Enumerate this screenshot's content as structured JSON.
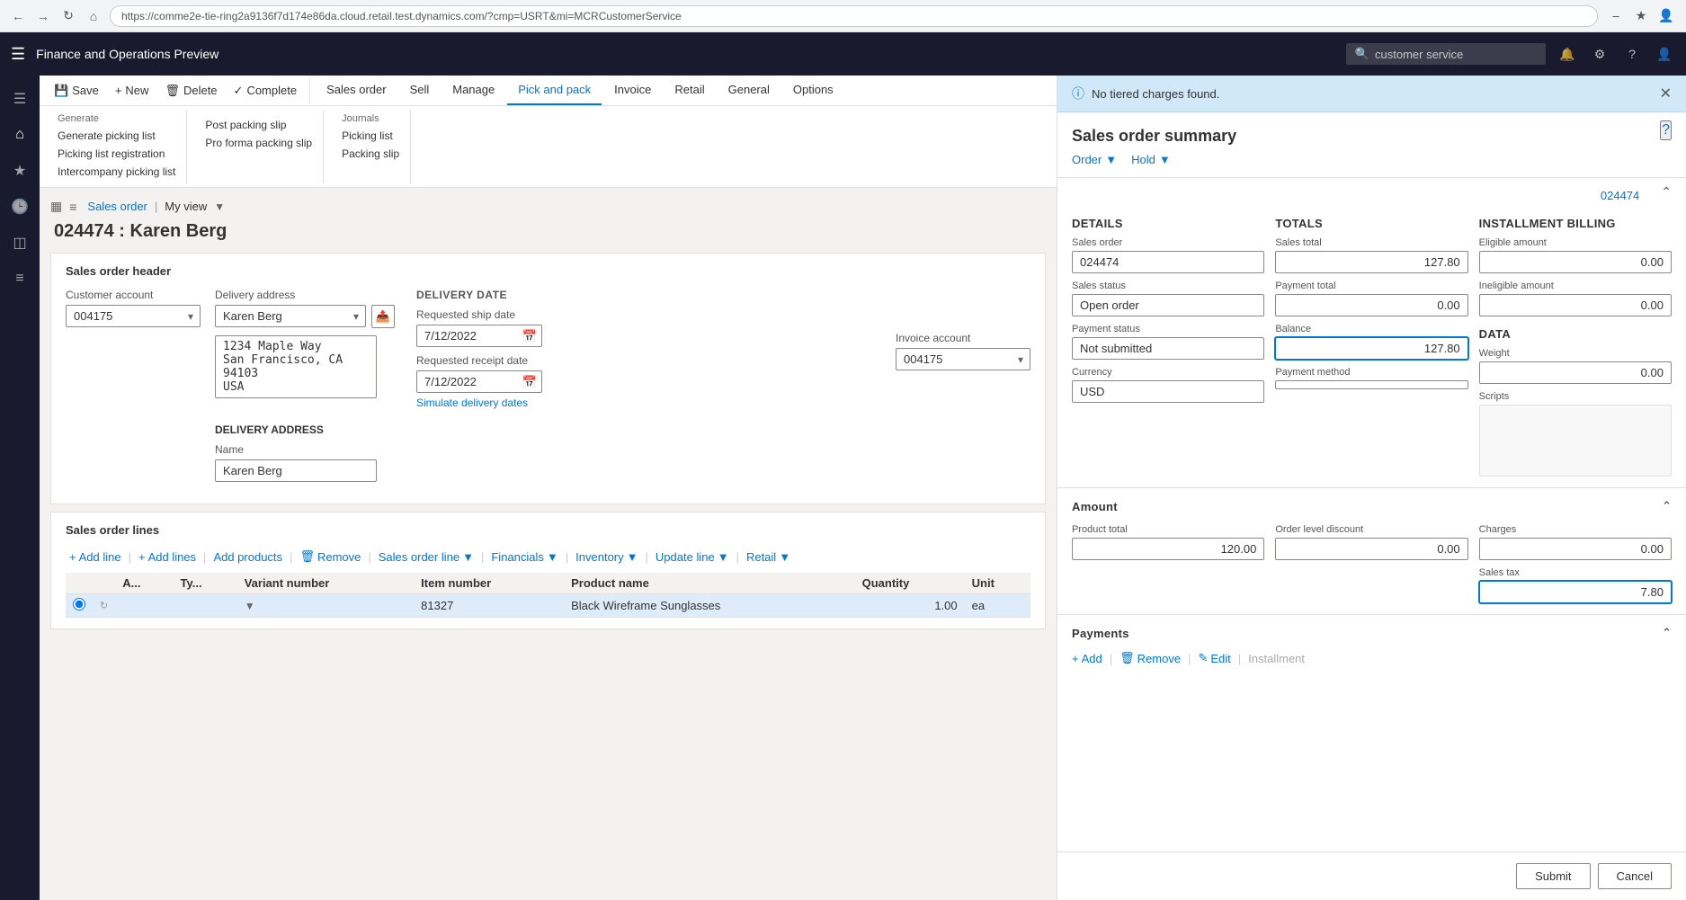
{
  "browser": {
    "url": "https://comme2e-tie-ring2a9136f7d174e86da.cloud.retail.test.dynamics.com/?cmp=USRT&mi=MCRCustomerService",
    "back": "←",
    "forward": "→",
    "refresh": "↻",
    "home": "⌂"
  },
  "app": {
    "title": "Finance and Operations Preview",
    "search_placeholder": "customer service"
  },
  "ribbon": {
    "actions": [
      {
        "label": "Save",
        "icon": "💾"
      },
      {
        "label": "New",
        "icon": "+"
      },
      {
        "label": "Delete",
        "icon": "🗑"
      },
      {
        "label": "Complete",
        "icon": "✓"
      }
    ],
    "tabs": [
      {
        "label": "Sales order"
      },
      {
        "label": "Sell"
      },
      {
        "label": "Manage"
      },
      {
        "label": "Pick and pack",
        "active": true
      },
      {
        "label": "Invoice"
      },
      {
        "label": "Retail"
      },
      {
        "label": "General"
      },
      {
        "label": "Options"
      }
    ],
    "groups": [
      {
        "label": "Generate",
        "items": [
          {
            "label": "Generate picking list",
            "disabled": false
          },
          {
            "label": "Picking list registration",
            "disabled": false
          },
          {
            "label": "Intercompany picking list",
            "disabled": false
          }
        ]
      },
      {
        "label": "",
        "items": [
          {
            "label": "Post packing slip",
            "disabled": false
          },
          {
            "label": "Pro forma packing slip",
            "disabled": false
          }
        ]
      },
      {
        "label": "Journals",
        "items": [
          {
            "label": "Picking list",
            "disabled": false
          },
          {
            "label": "Packing slip",
            "disabled": false
          }
        ]
      }
    ]
  },
  "filter": {
    "breadcrumb": "Sales order",
    "separator": "|",
    "view": "My view",
    "chevron": "▾"
  },
  "page_title": "024474 : Karen Berg",
  "form": {
    "header_title": "Sales order header",
    "customer_account_label": "Customer account",
    "customer_account_value": "004175",
    "invoice_account_label": "Invoice account",
    "invoice_account_value": "004175",
    "delivery_address_label": "Delivery address",
    "delivery_address_value": "Karen Berg",
    "address_block": "1234 Maple Way\nSan Francisco, CA 94103\nUSA",
    "delivery_section_label": "DELIVERY DATE",
    "requested_ship_label": "Requested ship date",
    "requested_ship_value": "7/12/2022",
    "requested_receipt_label": "Requested receipt date",
    "requested_receipt_value": "7/12/2022",
    "simulate_link": "Simulate delivery dates",
    "delivery_address_section_label": "DELIVERY ADDRESS",
    "name_label": "Name",
    "name_value": "Karen Berg"
  },
  "lines": {
    "section_title": "Sales order lines",
    "toolbar": [
      {
        "label": "Add line",
        "icon": "+"
      },
      {
        "label": "Add lines",
        "icon": "+"
      },
      {
        "label": "Add products",
        "icon": ""
      },
      {
        "label": "Remove",
        "icon": "🗑"
      },
      {
        "label": "Sales order line",
        "icon": "",
        "has_chevron": true
      },
      {
        "label": "Financials",
        "icon": "",
        "has_chevron": true
      },
      {
        "label": "Inventory",
        "icon": "",
        "has_chevron": true
      },
      {
        "label": "Update line",
        "icon": "",
        "has_chevron": true
      },
      {
        "label": "Retail",
        "icon": "",
        "has_chevron": true
      }
    ],
    "columns": [
      "",
      "",
      "A...",
      "Ty...",
      "Variant number",
      "Item number",
      "Product name",
      "Quantity",
      "Unit"
    ],
    "rows": [
      {
        "selected": true,
        "variant_number": "",
        "item_number": "81327",
        "product_name": "Black Wireframe Sunglasses",
        "quantity": "1.00",
        "unit": "ea"
      }
    ]
  },
  "right_panel": {
    "notification": "No tiered charges found.",
    "title": "Sales order summary",
    "order_btn": "Order",
    "hold_btn": "Hold",
    "order_id": "024474",
    "details_section": "DETAILS",
    "totals_section": "TOTALS",
    "installment_section": "INSTALLMENT BILLING",
    "sales_order_label": "Sales order",
    "sales_order_value": "024474",
    "sales_status_label": "Sales status",
    "sales_status_value": "Open order",
    "payment_status_label": "Payment status",
    "payment_status_value": "Not submitted",
    "currency_label": "Currency",
    "currency_value": "USD",
    "sales_total_label": "Sales total",
    "sales_total_value": "127.80",
    "payment_total_label": "Payment total",
    "payment_total_value": "0.00",
    "balance_label": "Balance",
    "balance_value": "127.80",
    "payment_method_label": "Payment method",
    "payment_method_value": "",
    "eligible_amount_label": "Eligible amount",
    "eligible_amount_value": "0.00",
    "ineligible_amount_label": "Ineligible amount",
    "ineligible_amount_value": "0.00",
    "data_section": "DATA",
    "weight_label": "Weight",
    "weight_value": "0.00",
    "scripts_label": "Scripts",
    "amount_section": "Amount",
    "product_total_label": "Product total",
    "product_total_value": "120.00",
    "order_discount_label": "Order level discount",
    "order_discount_value": "0.00",
    "charges_label": "Charges",
    "charges_value": "0.00",
    "sales_tax_label": "Sales tax",
    "sales_tax_value": "7.80",
    "payments_section": "Payments",
    "add_btn": "Add",
    "remove_btn": "Remove",
    "edit_btn": "Edit",
    "installment_btn": "Installment",
    "submit_btn": "Submit",
    "cancel_btn": "Cancel"
  },
  "sidebar": {
    "icons": [
      {
        "name": "hamburger-icon",
        "symbol": "≡"
      },
      {
        "name": "home-icon",
        "symbol": "⌂"
      },
      {
        "name": "star-icon",
        "symbol": "☆"
      },
      {
        "name": "clock-icon",
        "symbol": "🕒"
      },
      {
        "name": "grid-icon",
        "symbol": "⊞"
      },
      {
        "name": "list-icon",
        "symbol": "☰"
      }
    ]
  }
}
